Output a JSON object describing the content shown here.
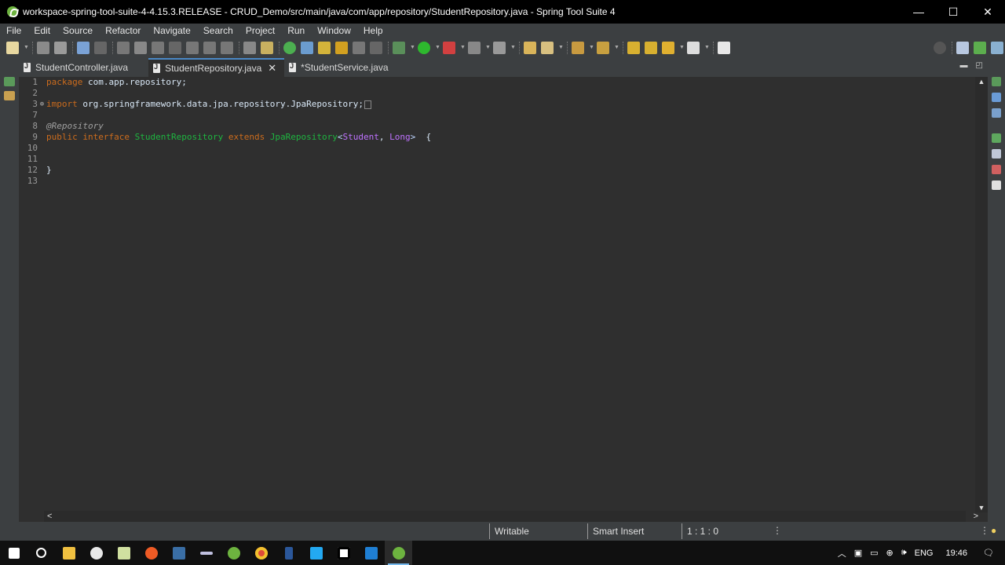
{
  "window": {
    "title": "workspace-spring-tool-suite-4-4.15.3.RELEASE - CRUD_Demo/src/main/java/com/app/repository/StudentRepository.java - Spring Tool Suite 4",
    "minimize": "—",
    "maximize": "☐",
    "close": "✕"
  },
  "menu": [
    "File",
    "Edit",
    "Source",
    "Refactor",
    "Navigate",
    "Search",
    "Project",
    "Run",
    "Window",
    "Help"
  ],
  "tabs": [
    {
      "label": "StudentController.java",
      "active": false
    },
    {
      "label": "StudentRepository.java",
      "active": true
    },
    {
      "label": "*StudentService.java",
      "active": false
    }
  ],
  "tab_close": "✕",
  "editor": {
    "lines": [
      {
        "n": "1",
        "fold": "",
        "parts": [
          [
            "kw",
            "package"
          ],
          [
            "plain",
            " com.app.repository;"
          ]
        ]
      },
      {
        "n": "2",
        "fold": "",
        "parts": []
      },
      {
        "n": "3",
        "fold": "⊕",
        "parts": [
          [
            "kw",
            "import"
          ],
          [
            "plain",
            " org.springframework.data.jpa.repository.JpaRepository;"
          ]
        ],
        "collapsed": true
      },
      {
        "n": "7",
        "fold": "",
        "parts": []
      },
      {
        "n": "8",
        "fold": "",
        "parts": [
          [
            "ann",
            "@Repository"
          ]
        ]
      },
      {
        "n": "9",
        "fold": "",
        "parts": [
          [
            "kw",
            "public"
          ],
          [
            "plain",
            " "
          ],
          [
            "kw",
            "interface"
          ],
          [
            "plain",
            " "
          ],
          [
            "typ",
            "StudentRepository"
          ],
          [
            "plain",
            " "
          ],
          [
            "kw",
            "extends"
          ],
          [
            "plain",
            " "
          ],
          [
            "typ",
            "JpaRepository"
          ],
          [
            "gen",
            "<"
          ],
          [
            "tparam",
            "Student"
          ],
          [
            "plain",
            ", "
          ],
          [
            "tparam",
            "Long"
          ],
          [
            "gen",
            ">"
          ],
          [
            "plain",
            "  {"
          ]
        ]
      },
      {
        "n": "10",
        "fold": "",
        "parts": []
      },
      {
        "n": "11",
        "fold": "",
        "parts": []
      },
      {
        "n": "12",
        "fold": "",
        "parts": [
          [
            "plain",
            "}"
          ]
        ]
      },
      {
        "n": "13",
        "fold": "",
        "parts": []
      }
    ]
  },
  "status": {
    "writable": "Writable",
    "insert_mode": "Smart Insert",
    "position": "1 : 1 : 0"
  },
  "tray": {
    "language": "ENG",
    "time": "19:46"
  },
  "colors": {
    "keyword": "#cc6c1d",
    "type": "#1eb540",
    "type_param": "#bf72ff",
    "annotation": "#a0a0a0"
  }
}
